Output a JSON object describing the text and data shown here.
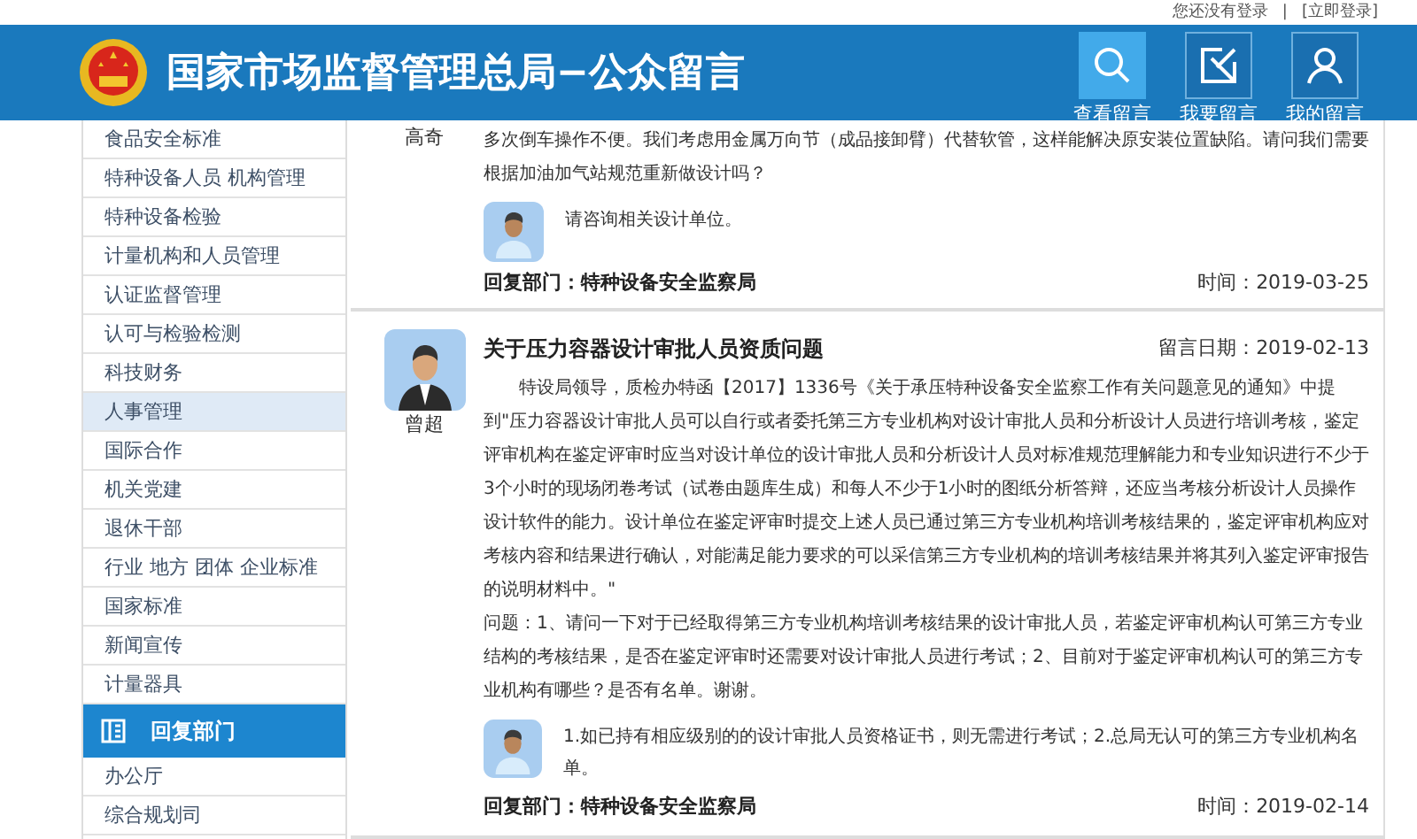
{
  "top_bar": {
    "login_status": "您还没有登录",
    "separator": "|",
    "login_link": "[立即登录]"
  },
  "header": {
    "title": "国家市场监督管理总局−公众留言",
    "actions": [
      {
        "kind": "search",
        "label": "查看留言",
        "selected": true
      },
      {
        "kind": "write",
        "label": "我要留言",
        "selected": false
      },
      {
        "kind": "user",
        "label": "我的留言",
        "selected": false
      }
    ]
  },
  "sidebar": {
    "items": [
      {
        "label": "食品安全标准",
        "selected": false
      },
      {
        "label": "特种设备人员 机构管理",
        "selected": false
      },
      {
        "label": "特种设备检验",
        "selected": false
      },
      {
        "label": "计量机构和人员管理",
        "selected": false
      },
      {
        "label": "认证监督管理",
        "selected": false
      },
      {
        "label": "认可与检验检测",
        "selected": false
      },
      {
        "label": "科技财务",
        "selected": false
      },
      {
        "label": "人事管理",
        "selected": true
      },
      {
        "label": "国际合作",
        "selected": false
      },
      {
        "label": "机关党建",
        "selected": false
      },
      {
        "label": "退休干部",
        "selected": false
      },
      {
        "label": "行业 地方 团体 企业标准",
        "selected": false
      },
      {
        "label": "国家标准",
        "selected": false
      },
      {
        "label": "新闻宣传",
        "selected": false
      },
      {
        "label": "计量器具",
        "selected": false
      }
    ],
    "section": {
      "title": "回复部门",
      "items": [
        {
          "label": "办公厅",
          "selected": false
        },
        {
          "label": "综合规划司",
          "selected": false
        }
      ]
    }
  },
  "posts": [
    {
      "author": "高奇",
      "paragraphs": [
        {
          "text": "多次倒车操作不便。我们考虑用金属万向节（成品接卸臂）代替软管，这样能解决原安装位置缺陷。请问我们需要根据加油加气站规范重新做设计吗？",
          "indented": false
        }
      ],
      "reply": "请咨询相关设计单位。",
      "reply_dept": "回复部门：特种设备安全监察局",
      "reply_time": "时间：2019-03-25"
    },
    {
      "author": "曾超",
      "title": "关于压力容器设计审批人员资质问题",
      "date": "留言日期：2019-02-13",
      "paragraphs": [
        {
          "text": "特设局领导，质检办特函【2017】1336号《关于承压特种设备安全监察工作有关问题意见的通知》中提到\"压力容器设计审批人员可以自行或者委托第三方专业机构对设计审批人员和分析设计人员进行培训考核，鉴定评审机构在鉴定评审时应当对设计单位的设计审批人员和分析设计人员对标准规范理解能力和专业知识进行不少于3个小时的现场闭卷考试（试卷由题库生成）和每人不少于1小时的图纸分析答辩，还应当考核分析设计人员操作设计软件的能力。设计单位在鉴定评审时提交上述人员已通过第三方专业机构培训考核结果的，鉴定评审机构应对考核内容和结果进行确认，对能满足能力要求的可以采信第三方专业机构的培训考核结果并将其列入鉴定评审报告的说明材料中。\"",
          "indented": true
        },
        {
          "text": "问题：1、请问一下对于已经取得第三方专业机构培训考核结果的设计审批人员，若鉴定评审机构认可第三方专业结构的考核结果，是否在鉴定评审时还需要对设计审批人员进行考试；2、目前对于鉴定评审机构认可的第三方专业机构有哪些？是否有名单。谢谢。",
          "indented": false
        }
      ],
      "reply": "1.如已持有相应级别的的设计审批人员资格证书，则无需进行考试；2.总局无认可的第三方专业机构名单。",
      "reply_dept": "回复部门：特种设备安全监察局",
      "reply_time": "时间：2019-02-14"
    }
  ]
}
